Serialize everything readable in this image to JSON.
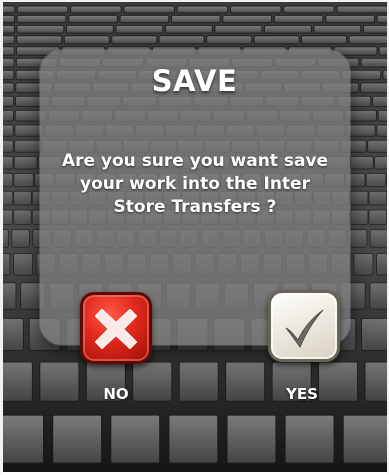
{
  "dialog": {
    "title": "SAVE",
    "message": "Are you sure you want save your work into the Inter Store Transfers ?",
    "buttons": {
      "no": {
        "label": "NO",
        "icon": "close-x-icon",
        "color": "#e0281c"
      },
      "yes": {
        "label": "YES",
        "icon": "checkmark-icon",
        "color": "#f1ede4"
      }
    }
  },
  "background": {
    "pattern": "3d-keyboard-grid-icon",
    "color": "#2a2a2a"
  }
}
